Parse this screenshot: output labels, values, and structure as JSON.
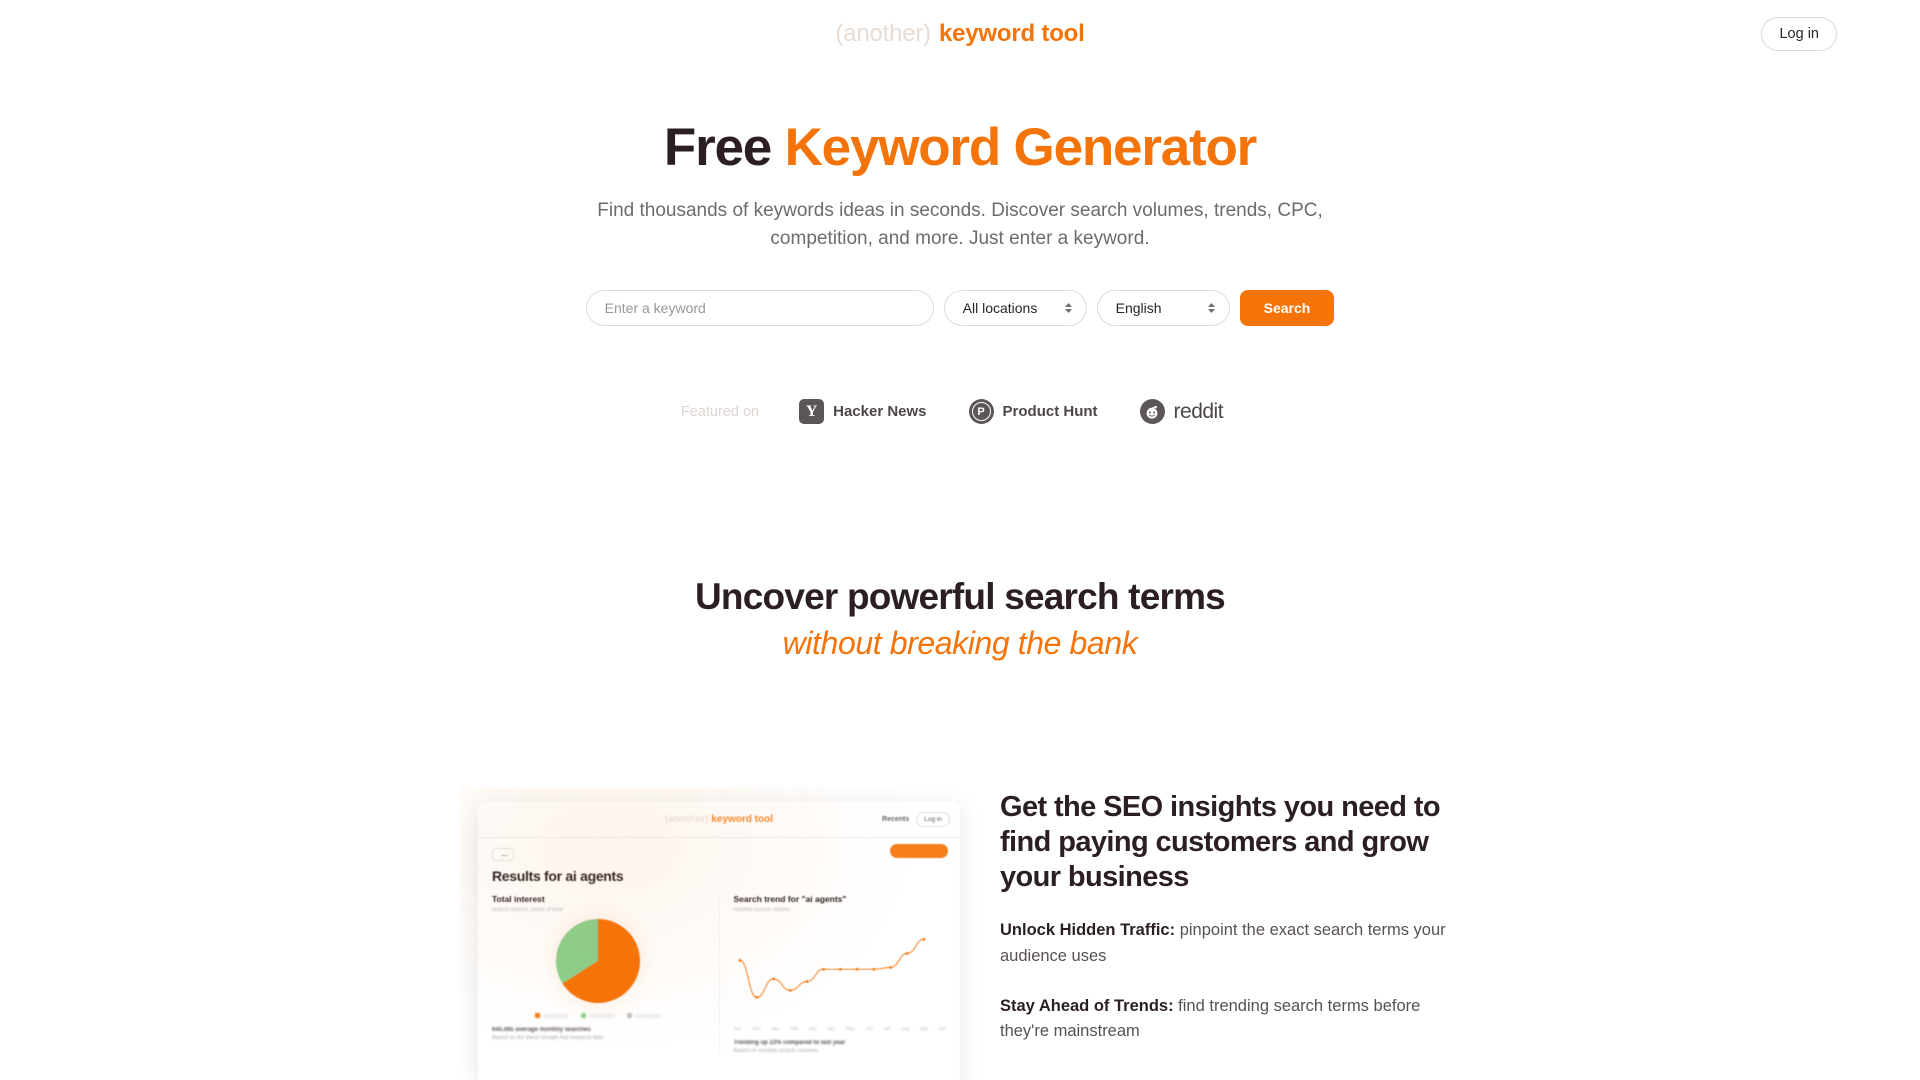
{
  "header": {
    "logo_prefix": "(another)",
    "logo_main": "keyword tool",
    "login_label": "Log in"
  },
  "hero": {
    "title_plain": "Free ",
    "title_accent": "Keyword Generator",
    "subtitle": "Find thousands of keywords ideas in seconds. Discover search volumes, trends, CPC, competition, and more. Just enter a keyword."
  },
  "search": {
    "keyword_placeholder": "Enter a keyword",
    "keyword_value": "",
    "location_selected": "All locations",
    "language_selected": "English",
    "submit_label": "Search"
  },
  "featured": {
    "label": "Featured on",
    "items": [
      {
        "name": "Hacker News",
        "badge": "Y"
      },
      {
        "name": "Product Hunt",
        "badge": "P"
      },
      {
        "name": "reddit",
        "badge": ""
      }
    ]
  },
  "section2": {
    "line1": "Uncover powerful search terms",
    "line2": "without breaking the bank"
  },
  "preview": {
    "logo_prefix": "(another)",
    "logo_main": "keyword tool",
    "nav_link": "Recents",
    "nav_button": "Log in",
    "results_title": "Results for ai agents",
    "pie_panel_title": "Total interest",
    "pie_panel_sub": "search volume, share of total",
    "pie_footer_line1": "640,495 average monthly searches",
    "pie_footer_line2": "Based on the latest Google Ads keyword data",
    "trend_panel_title": "Search trend for \"ai agents\"",
    "trend_panel_sub": "monthly search volume",
    "trend_footer_line1": "Trending up 22% compared to last year",
    "trend_footer_line2": "Based on monthly search volumes"
  },
  "copy": {
    "heading": "Get the SEO insights you need to find paying customers and grow your business",
    "bullets": [
      {
        "bold": "Unlock Hidden Traffic:",
        "text": " pinpoint the exact search terms your audience uses"
      },
      {
        "bold": "Stay Ahead of Trends:",
        "text": " find trending search terms before they're mainstream"
      }
    ]
  },
  "colors": {
    "accent": "#F5740A",
    "text_dark": "#2b1f22",
    "text_muted": "#6f6a6c",
    "pie_green": "#8ccf8e"
  },
  "chart_data": [
    {
      "type": "pie",
      "title": "Total interest",
      "labels": [
        "Primary share",
        "Secondary share"
      ],
      "values": [
        66,
        34
      ],
      "colors": [
        "#F5740A",
        "#8ccf8e"
      ],
      "legend": "bottom"
    },
    {
      "type": "line",
      "title": "Search trend for \"ai agents\"",
      "xlabel": "",
      "ylabel": "",
      "categories": [
        "Nov",
        "Dec",
        "Jan",
        "Feb",
        "Mar",
        "Apr",
        "May",
        "Jun",
        "Jul",
        "Aug",
        "Sep",
        "Oct"
      ],
      "values": [
        62,
        20,
        41,
        28,
        38,
        52,
        52,
        52,
        52,
        54,
        70,
        86
      ],
      "ylim": [
        0,
        100
      ],
      "grid": false,
      "series_color": "#F5740A"
    }
  ]
}
